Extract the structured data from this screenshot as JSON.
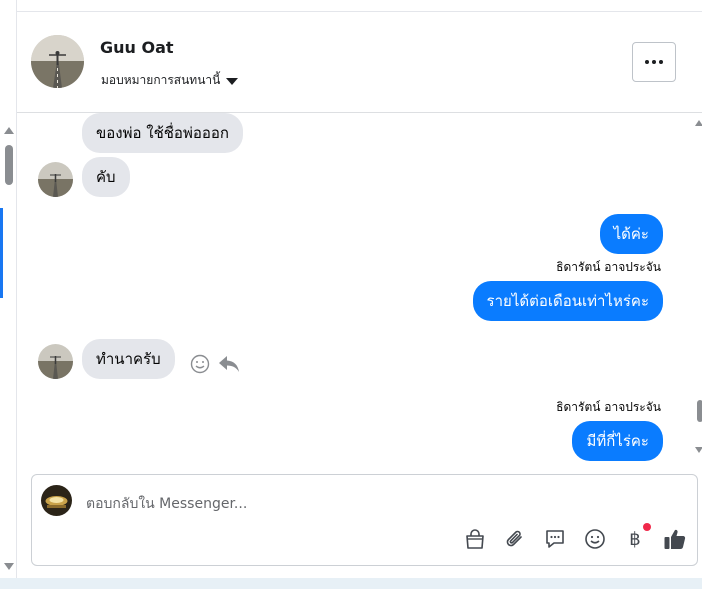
{
  "header": {
    "contact_name": "Guu Oat",
    "assign_label": "มอบหมายการสนทนานี้"
  },
  "messages": [
    {
      "dir": "in",
      "text": "ของพ่อ ใช้ชื่อพ่อออก"
    },
    {
      "dir": "in",
      "text": "คับ"
    },
    {
      "dir": "out",
      "text": "ได้ค่ะ"
    },
    {
      "dir": "out",
      "sender": "ธิดารัตน์ อาจประจัน",
      "text": "รายได้ต่อเดือนเท่าไหร่คะ"
    },
    {
      "dir": "in",
      "text": "ทำนาครับ"
    },
    {
      "dir": "out",
      "sender": "ธิดารัตน์ อาจประจัน",
      "text": "มีที่กี่ไร่คะ"
    }
  ],
  "composer": {
    "placeholder": "ตอบกลับใน Messenger...",
    "baht_symbol": "฿"
  },
  "colors": {
    "outgoing_bubble": "#0a7cff",
    "incoming_bubble": "#e4e6eb",
    "notification_dot": "#f0284a"
  }
}
